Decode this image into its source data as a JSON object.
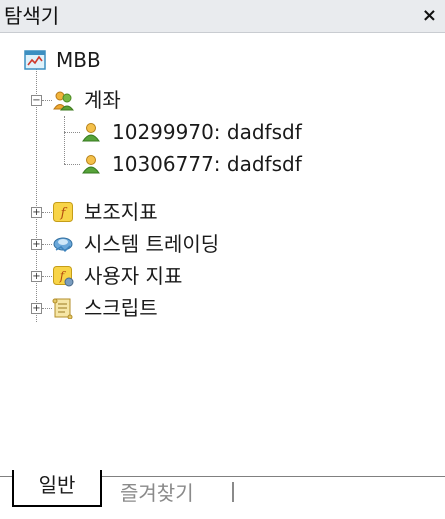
{
  "panel": {
    "title": "탐색기",
    "close": "×"
  },
  "tree": {
    "root": {
      "label": "MBB",
      "icon": "chart-window-icon"
    },
    "account": {
      "label": "계좌",
      "icon": "users-icon",
      "items": [
        {
          "label": "10299970: dadfsdf",
          "icon": "user-icon"
        },
        {
          "label": "10306777: dadfsdf",
          "icon": "user-icon"
        }
      ]
    },
    "nodes": [
      {
        "label": "보조지표",
        "icon": "indicator-icon"
      },
      {
        "label": "시스템 트레이딩",
        "icon": "system-trading-icon"
      },
      {
        "label": "사용자 지표",
        "icon": "custom-indicator-icon"
      },
      {
        "label": "스크립트",
        "icon": "script-icon"
      }
    ]
  },
  "tabs": {
    "active": "일반",
    "inactive": "즐겨찾기"
  }
}
